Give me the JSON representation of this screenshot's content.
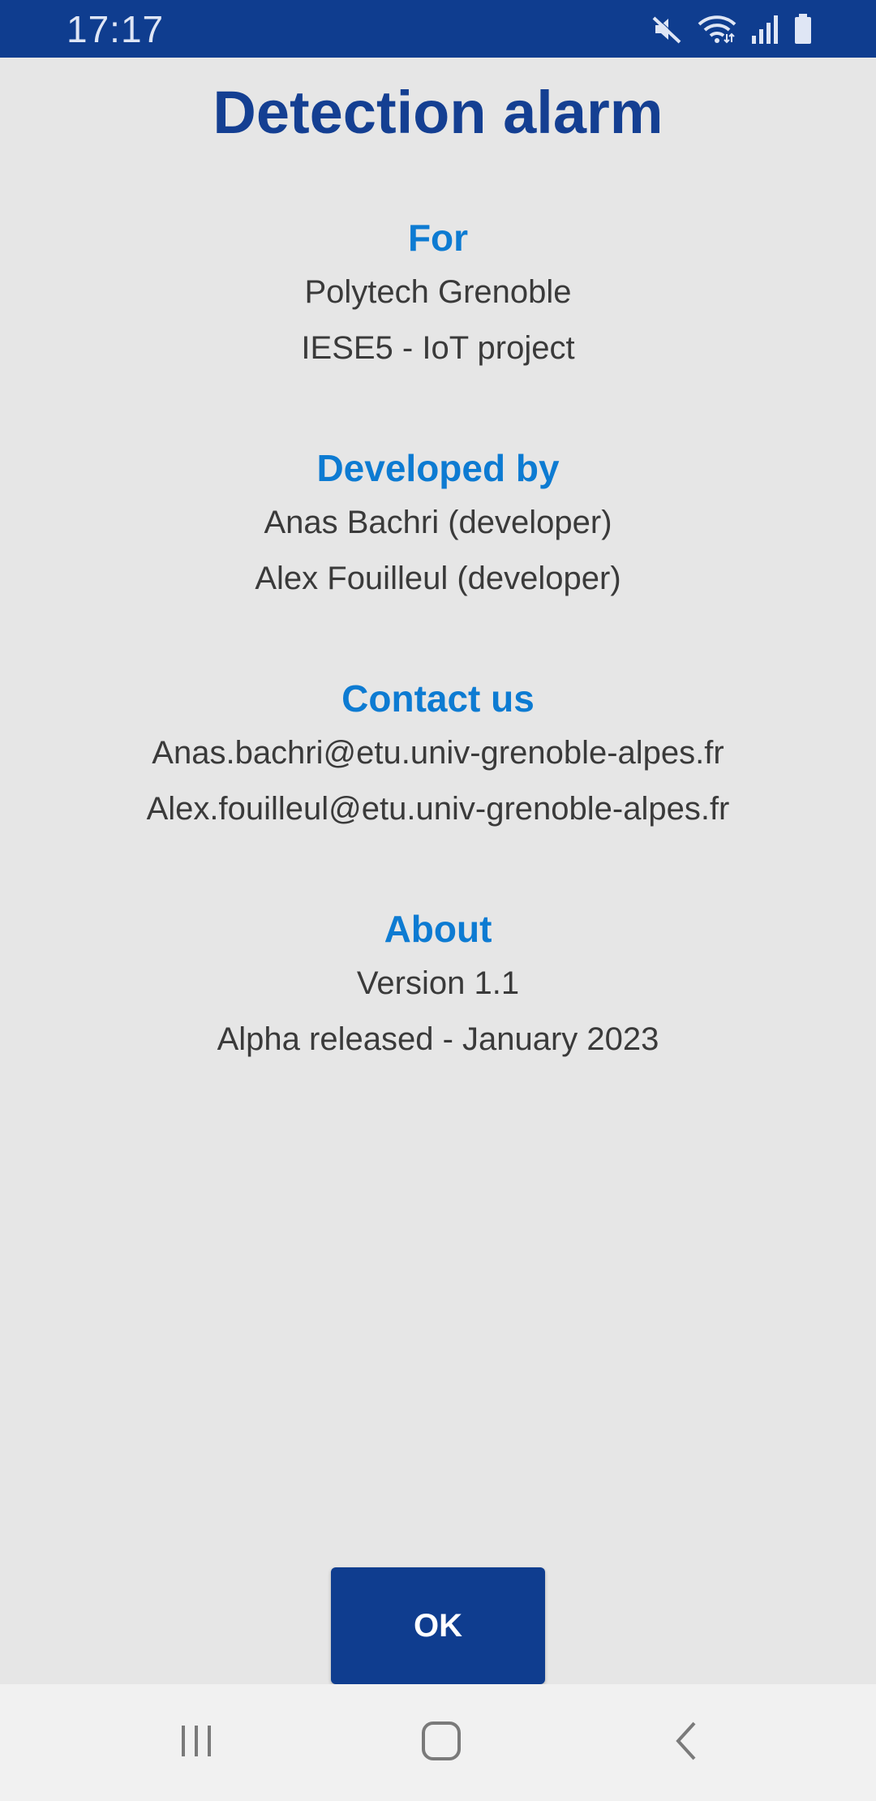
{
  "status_bar": {
    "time": "17:17",
    "icons": [
      "mute-icon",
      "wifi-icon",
      "signal-icon",
      "battery-icon"
    ]
  },
  "dialog": {
    "title": "Detection alarm",
    "sections": [
      {
        "heading": "For",
        "lines": [
          "Polytech Grenoble",
          "IESE5 - IoT project"
        ]
      },
      {
        "heading": "Developed by",
        "lines": [
          "Anas Bachri (developer)",
          "Alex Fouilleul (developer)"
        ]
      },
      {
        "heading": "Contact us",
        "lines": [
          "Anas.bachri@etu.univ-grenoble-alpes.fr",
          "Alex.fouilleul@etu.univ-grenoble-alpes.fr"
        ]
      },
      {
        "heading": "About",
        "lines": [
          "Version 1.1",
          "Alpha released - January 2023"
        ]
      }
    ],
    "ok_label": "OK"
  },
  "nav_bar": {
    "icons": [
      "recents-icon",
      "home-icon",
      "back-icon"
    ]
  },
  "colors": {
    "primary": "#0f3d8f",
    "heading": "#0d7bd2",
    "background": "#e6e6e6",
    "text": "#3a3a3a"
  }
}
